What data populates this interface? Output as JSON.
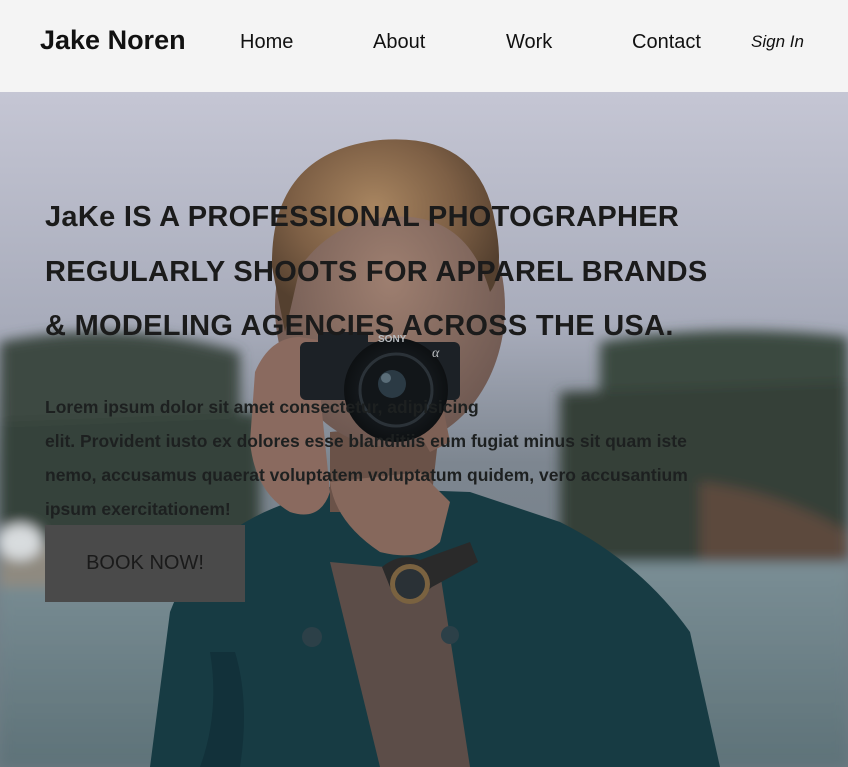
{
  "nav": {
    "brand": "Jake Noren",
    "links": [
      "Home",
      "About",
      "Work",
      "Contact"
    ],
    "signin": "Sign In"
  },
  "hero": {
    "headline_lines": [
      "JaKe IS A PROFESSIONAL PHOTOGRAPHER",
      "REGULARLY SHOOTS FOR APPAREL BRANDS",
      "& MODELING AGENCIES ACROSS THE USA."
    ],
    "lead_lines": [
      "Lorem ipsum dolor sit amet consectetur, adipisicing",
      "elit. Provident iusto ex dolores esse blanditiis eum fugiat minus sit quam iste",
      "nemo, accusamus quaerat voluptatem voluptatum quidem, vero accusantium",
      "ipsum exercitationem!"
    ],
    "button_label": "BOOK NOW!",
    "camera_brand": "SONY"
  },
  "colors": {
    "nav_bg": "#f4f4f4",
    "button_bg": "#4a4a4a",
    "jacket": "#193d45",
    "sky": "#c4c6d4"
  }
}
